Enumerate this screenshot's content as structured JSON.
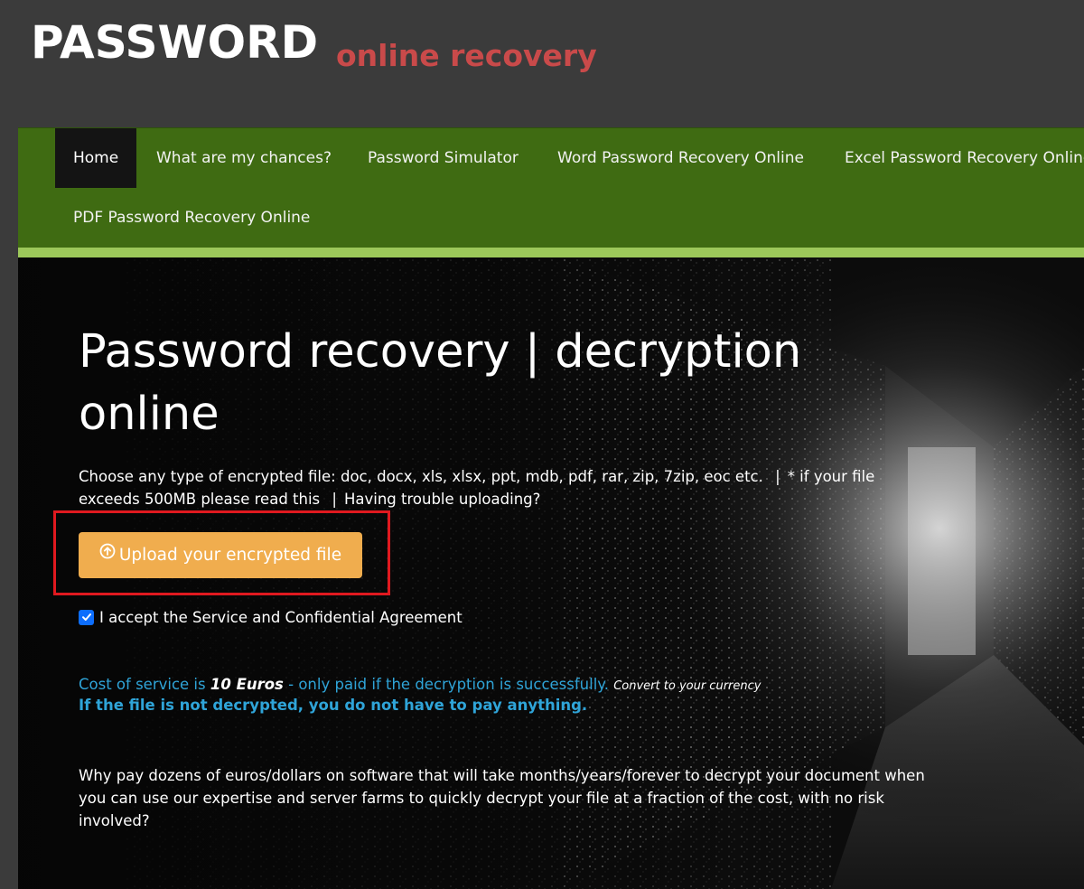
{
  "header": {
    "logo_main": "PASSWORD",
    "logo_sub": "online recovery"
  },
  "nav": {
    "items": [
      {
        "label": "Home",
        "active": true
      },
      {
        "label": "What are my chances?"
      },
      {
        "label": "Password Simulator"
      },
      {
        "label": "Word Password Recovery Online"
      },
      {
        "label": "Excel Password Recovery Online"
      },
      {
        "label": "PDF Password Recovery Online"
      }
    ]
  },
  "hero": {
    "title": "Password recovery | decryption online",
    "intro_text": "Choose any type of encrypted file: doc, docx, xls, xlsx, ppt, mdb, pdf, rar, zip, 7zip, eoc etc.",
    "separator": "|",
    "large_file_link": "* if your file exceeds 500MB please read this",
    "trouble_link": "Having trouble uploading?",
    "upload_button": "Upload your encrypted file",
    "agreement": "I accept the Service and Confidential Agreement",
    "agreement_checked": true,
    "cost_prefix": "Cost of service is ",
    "cost_price": "10 Euros",
    "cost_suffix": " - only paid if the decryption is successfully.",
    "convert_link": "Convert to your currency",
    "cost_guarantee": "If the file is not decrypted, you do not have to pay anything.",
    "why_text": "Why pay dozens of euros/dollars on software that will take months/years/forever to decrypt your document when you can use our expertise and server farms to quickly decrypt your file at a fraction of the cost, with no risk involved?"
  },
  "colors": {
    "page_bg": "#3b3b3b",
    "nav_bg": "#3f6b12",
    "nav_strip": "#9cc85a",
    "logo_sub": "#c94a4a",
    "upload_button": "#f0ad4e",
    "cost_text": "#2fa4d8",
    "highlight_border": "#e0191f"
  },
  "icons": {
    "upload": "arrow-up-circle-icon",
    "checkbox": "check-icon"
  }
}
